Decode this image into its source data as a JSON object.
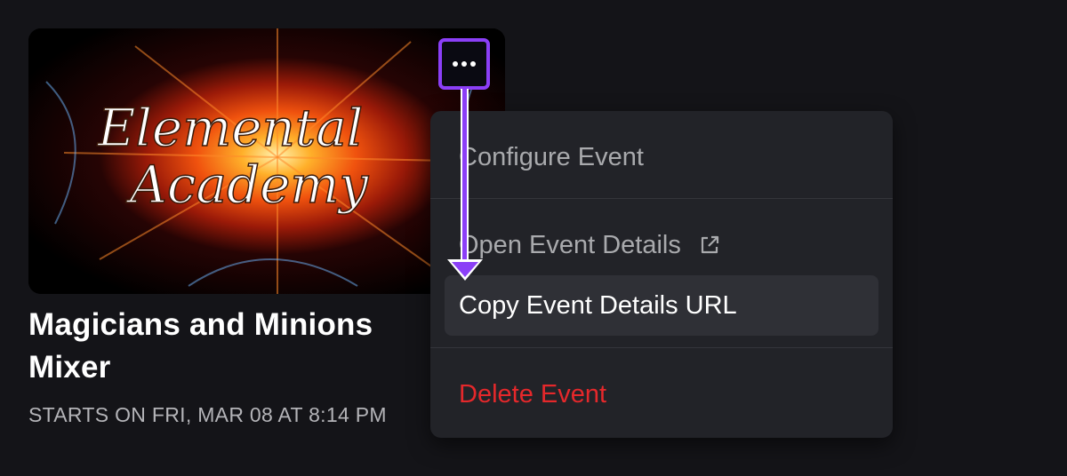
{
  "event": {
    "image": {
      "title_line1": "Elemental",
      "title_line2": "Academy"
    },
    "title": "Magicians and Minions Mixer",
    "start_text": "STARTS ON FRI, MAR 08 AT 8:14 PM"
  },
  "more_button": {
    "icon": "more-horizontal-icon",
    "highlight_color": "#8b3ff7"
  },
  "menu": {
    "items": [
      {
        "label": "Configure Event"
      },
      {
        "label": "Open Event Details",
        "icon": "external-link-icon"
      },
      {
        "label": "Copy Event Details URL",
        "state": "hovered"
      },
      {
        "label": "Delete Event",
        "tone": "danger"
      }
    ]
  },
  "colors": {
    "background": "#141418",
    "menu_background": "#222328",
    "danger": "#e5282b",
    "accent": "#8b3ff7"
  }
}
